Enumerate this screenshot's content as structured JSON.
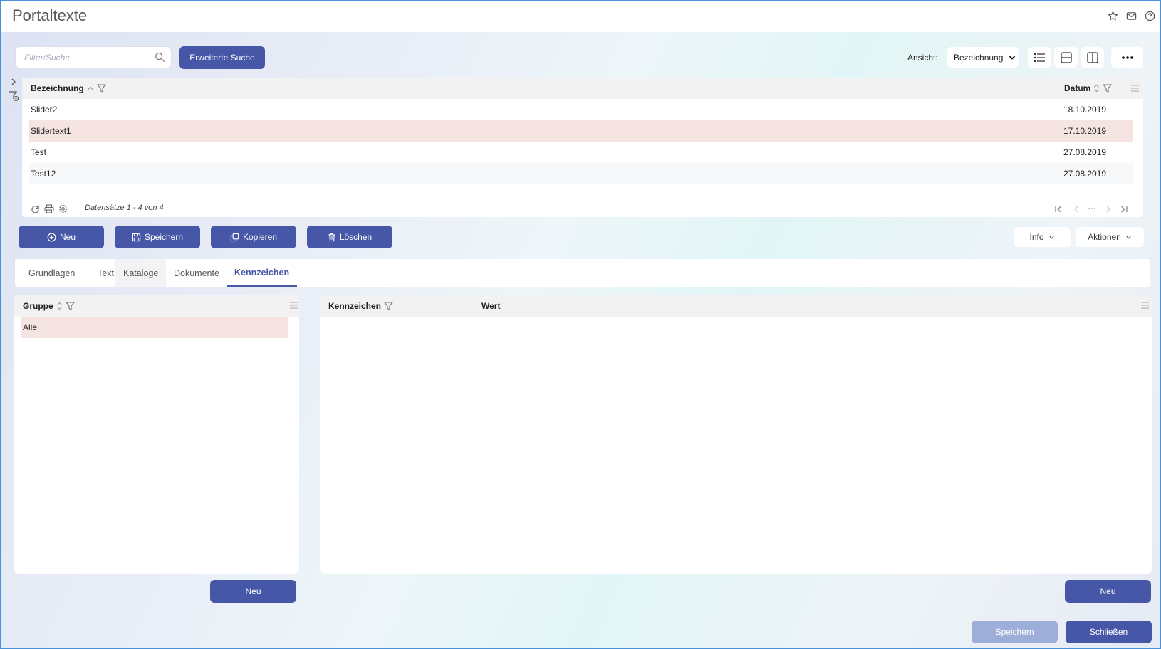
{
  "app": {
    "title": "Portaltexte"
  },
  "search": {
    "placeholder": "Filter/Suche",
    "value": "",
    "advanced_label": "Erweiterte Suche"
  },
  "view": {
    "label": "Ansicht:",
    "selected": "Bezeichnung",
    "options": [
      "Bezeichnung"
    ]
  },
  "grid": {
    "columns": {
      "name": "Bezeichnung",
      "date": "Datum"
    },
    "rows": [
      {
        "name": "Slider2",
        "date": "18.10.2019"
      },
      {
        "name": "Slidertext1",
        "date": "17.10.2019",
        "selected": true
      },
      {
        "name": "Test",
        "date": "27.08.2019"
      },
      {
        "name": "Test12",
        "date": "27.08.2019"
      }
    ],
    "status": "Datensätze 1 - 4 von 4",
    "pager_more": "···"
  },
  "toolbar": {
    "new": "Neu",
    "save": "Speichern",
    "copy": "Kopieren",
    "delete": "Löschen",
    "info": "Info",
    "actions": "Aktionen"
  },
  "tabs": [
    {
      "label": "Grundlagen"
    },
    {
      "label": "Text"
    },
    {
      "label": "Kataloge"
    },
    {
      "label": "Dokumente"
    },
    {
      "label": "Kennzeichen",
      "active": true
    }
  ],
  "groups_panel": {
    "column": "Gruppe",
    "rows": [
      "Alle"
    ],
    "new_label": "Neu"
  },
  "flags_panel": {
    "columns": {
      "flag": "Kennzeichen",
      "value": "Wert"
    },
    "new_label": "Neu"
  },
  "footer": {
    "save": "Speichern",
    "close": "Schließen"
  },
  "colors": {
    "accent": "#4657a8",
    "accent_disabled": "#9daed8",
    "selected_row": "#f6e4e2",
    "border": "#4a90d9"
  }
}
